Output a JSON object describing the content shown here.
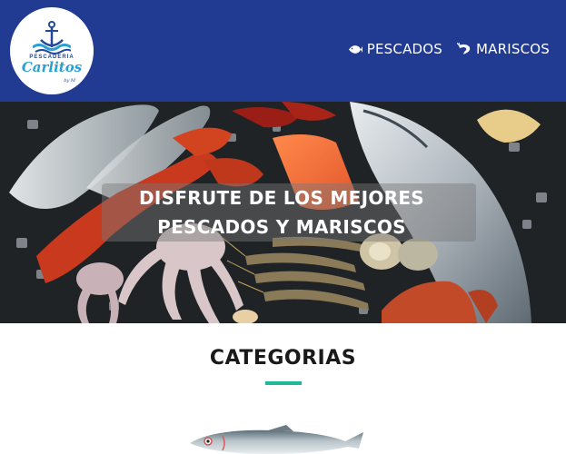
{
  "header": {
    "logo": {
      "sub_text": "PESCADERIA",
      "main_text": "Carlitos",
      "by_text": "by M"
    },
    "nav": [
      {
        "label": "PESCADOS",
        "icon": "fish-icon"
      },
      {
        "label": "MARISCOS",
        "icon": "shrimp-icon"
      }
    ],
    "colors": {
      "background": "#213a92",
      "text": "#ffffff"
    }
  },
  "hero": {
    "title": "DISFRUTE DE LOS MEJORES PESCADOS Y MARISCOS"
  },
  "categories": {
    "title": "CATEGORIAS",
    "accent_color": "#1fb99a"
  }
}
